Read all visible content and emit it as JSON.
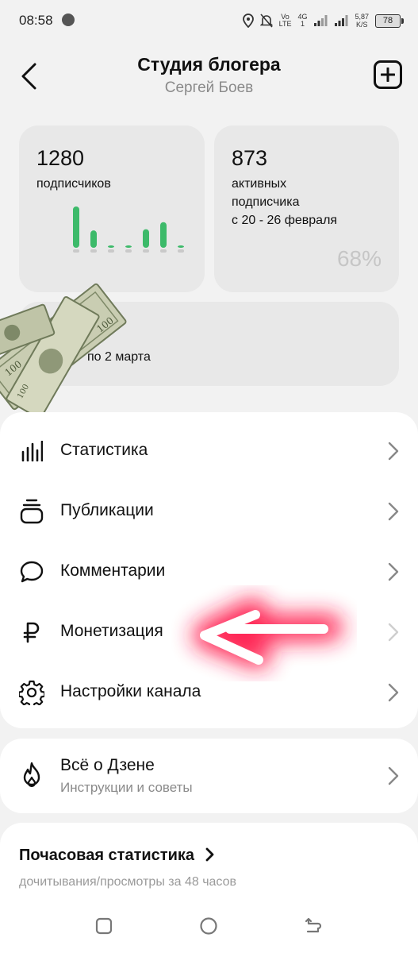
{
  "status_bar": {
    "time": "08:58",
    "net1_top": "Vo",
    "net1_bottom": "LTE",
    "net2": "4G",
    "speed_value": "5,87",
    "speed_unit": "K/S",
    "battery": "78"
  },
  "header": {
    "title": "Студия блогера",
    "subtitle": "Сергей Боев"
  },
  "stats": {
    "subscribers": {
      "value": "1280",
      "label": "подписчиков",
      "bars": [
        1.0,
        0.42,
        0.05,
        0.05,
        0.45,
        0.62,
        0.05
      ]
    },
    "active": {
      "value": "873",
      "label_line1": "активных",
      "label_line2": "подписчика",
      "label_line3": "с 20 - 26 февраля",
      "percent": "68%"
    },
    "third_card_text": "по 2 марта"
  },
  "menu": {
    "items": [
      {
        "label": "Статистика",
        "icon": "bar-chart-icon"
      },
      {
        "label": "Публикации",
        "icon": "publications-icon"
      },
      {
        "label": "Комментарии",
        "icon": "comment-icon"
      },
      {
        "label": "Монетизация",
        "icon": "ruble-icon"
      },
      {
        "label": "Настройки канала",
        "icon": "gear-icon"
      }
    ]
  },
  "dzen": {
    "label": "Всё о Дзене",
    "sublabel": "Инструкции и советы",
    "icon": "flame-icon"
  },
  "hourly": {
    "title": "Почасовая статистика",
    "subtitle": "дочитывания/просмотры за 48 часов"
  },
  "colors": {
    "accent_green": "#3dba6a",
    "arrow_red": "#ff1f4d"
  }
}
